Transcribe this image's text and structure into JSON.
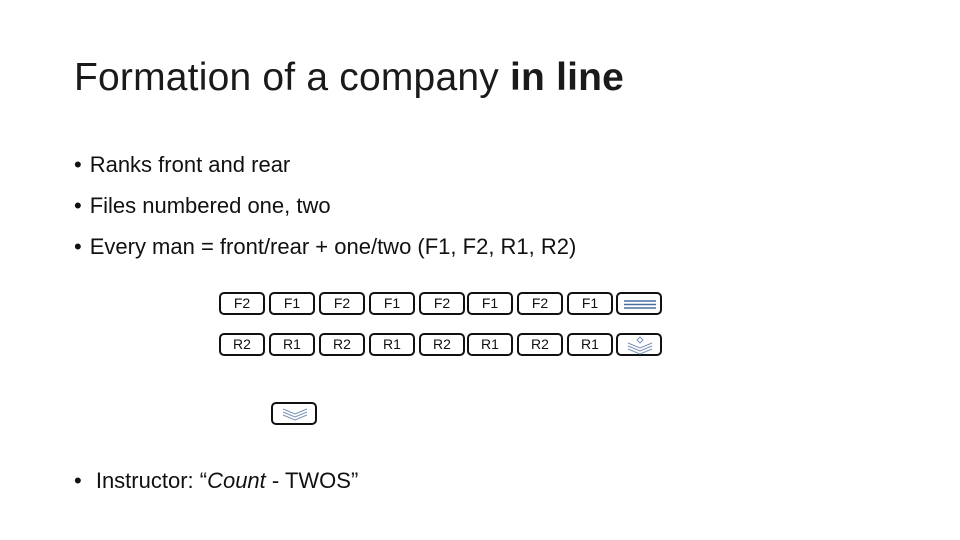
{
  "title": {
    "main": "Formation of a company",
    "bold": "in line"
  },
  "bullets": [
    "Ranks front and rear",
    "Files numbered one, two",
    "Every man = front/rear + one/two (F1, F2, R1, R2)"
  ],
  "formation": {
    "front_rank": [
      "F2",
      "F1",
      "F2",
      "F1",
      "F2",
      "F1",
      "F2",
      "F1"
    ],
    "rear_rank": [
      "R2",
      "R1",
      "R2",
      "R1",
      "R2",
      "R1",
      "R2",
      "R1"
    ],
    "front_end_icon": "guidon-lines-icon",
    "rear_end_icon": "chevron-stack-icon",
    "instructor_icon": "chevron-stack-icon",
    "icon_color": "#4a6fa5"
  },
  "instructor": {
    "label": "Instructor: ",
    "quote_open": "“",
    "command_italic": "Count",
    "command_rest": " - TWOS",
    "quote_close": "”"
  }
}
